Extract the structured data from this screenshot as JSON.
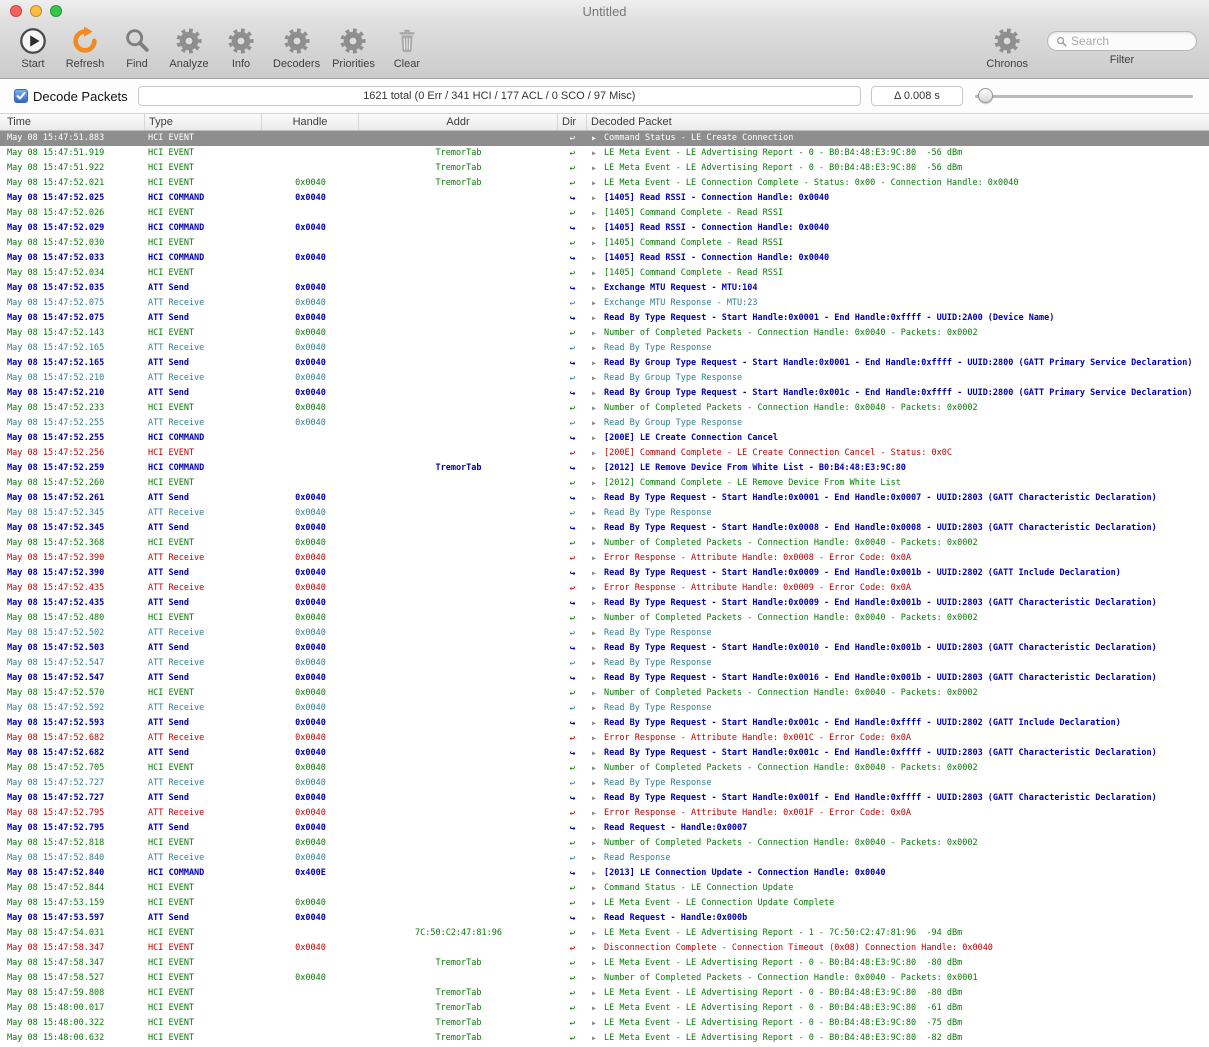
{
  "window": {
    "title": "Untitled"
  },
  "toolbar": {
    "items": [
      {
        "label": "Start",
        "icon": "play"
      },
      {
        "label": "Refresh",
        "icon": "refresh"
      },
      {
        "label": "Find",
        "icon": "search"
      },
      {
        "label": "Analyze",
        "icon": "gear"
      },
      {
        "label": "Info",
        "icon": "gear"
      },
      {
        "label": "Decoders",
        "icon": "gear"
      },
      {
        "label": "Priorities",
        "icon": "gear"
      },
      {
        "label": "Clear",
        "icon": "trash"
      }
    ],
    "chronos": {
      "label": "Chronos",
      "icon": "gear"
    },
    "filter": {
      "label": "Filter",
      "placeholder": "Search"
    }
  },
  "controls": {
    "decode_packets_label": "Decode Packets",
    "decode_packets_checked": true,
    "summary": "1621 total (0 Err / 341 HCI / 177 ACL / 0 SCO / 97 Misc)",
    "delta": "Δ 0.008 s"
  },
  "icons": {
    "dir_in": "↩",
    "dir_out": "↪",
    "disclosure": "▶"
  },
  "colors": {
    "traffic_lights": [
      "#FC605C",
      "#FDBC40",
      "#34C749"
    ],
    "row_green": "#077A07",
    "row_blue": "#0000B4",
    "row_red": "#C00000",
    "row_teal": "#2E7E8E",
    "selected_bg": "#8E8E8E",
    "selected_text": "#FFFFFF",
    "checkbox_blue": "#2E66D0",
    "accent_orange": "#F28A22"
  },
  "table": {
    "columns": [
      "Time",
      "Type",
      "Handle",
      "Addr",
      "Dir",
      "Decoded Packet"
    ],
    "rows": [
      {
        "time": "May 08 15:47:51.883",
        "type": "HCI EVENT",
        "handle": "",
        "addr": "",
        "dir": "in",
        "packet": "Command Status - LE Create Connection",
        "color": "selected"
      },
      {
        "time": "May 08 15:47:51.919",
        "type": "HCI EVENT",
        "handle": "",
        "addr": "TremorTab",
        "dir": "in",
        "packet": "LE Meta Event - LE Advertising Report - 0 - B0:B4:48:E3:9C:80  -56 dBm",
        "color": "green"
      },
      {
        "time": "May 08 15:47:51.922",
        "type": "HCI EVENT",
        "handle": "",
        "addr": "TremorTab",
        "dir": "in",
        "packet": "LE Meta Event - LE Advertising Report - 0 - B0:B4:48:E3:9C:80  -56 dBm",
        "color": "green"
      },
      {
        "time": "May 08 15:47:52.021",
        "type": "HCI EVENT",
        "handle": "0x0040",
        "addr": "TremorTab",
        "dir": "in",
        "packet": "LE Meta Event - LE Connection Complete - Status: 0x00 - Connection Handle: 0x0040",
        "color": "green"
      },
      {
        "time": "May 08 15:47:52.025",
        "type": "HCI COMMAND",
        "handle": "0x0040",
        "addr": "",
        "dir": "out",
        "packet": "[1405] Read RSSI - Connection Handle: 0x0040",
        "color": "blue"
      },
      {
        "time": "May 08 15:47:52.026",
        "type": "HCI EVENT",
        "handle": "",
        "addr": "",
        "dir": "in",
        "packet": "[1405] Command Complete - Read RSSI",
        "color": "green"
      },
      {
        "time": "May 08 15:47:52.029",
        "type": "HCI COMMAND",
        "handle": "0x0040",
        "addr": "",
        "dir": "out",
        "packet": "[1405] Read RSSI - Connection Handle: 0x0040",
        "color": "blue"
      },
      {
        "time": "May 08 15:47:52.030",
        "type": "HCI EVENT",
        "handle": "",
        "addr": "",
        "dir": "in",
        "packet": "[1405] Command Complete - Read RSSI",
        "color": "green"
      },
      {
        "time": "May 08 15:47:52.033",
        "type": "HCI COMMAND",
        "handle": "0x0040",
        "addr": "",
        "dir": "out",
        "packet": "[1405] Read RSSI - Connection Handle: 0x0040",
        "color": "blue"
      },
      {
        "time": "May 08 15:47:52.034",
        "type": "HCI EVENT",
        "handle": "",
        "addr": "",
        "dir": "in",
        "packet": "[1405] Command Complete - Read RSSI",
        "color": "green"
      },
      {
        "time": "May 08 15:47:52.035",
        "type": "ATT Send",
        "handle": "0x0040",
        "addr": "",
        "dir": "out",
        "packet": "Exchange MTU Request - MTU:104",
        "color": "blue"
      },
      {
        "time": "May 08 15:47:52.075",
        "type": "ATT Receive",
        "handle": "0x0040",
        "addr": "",
        "dir": "in",
        "packet": "Exchange MTU Response - MTU:23",
        "color": "teal"
      },
      {
        "time": "May 08 15:47:52.075",
        "type": "ATT Send",
        "handle": "0x0040",
        "addr": "",
        "dir": "out",
        "packet": "Read By Type Request - Start Handle:0x0001 - End Handle:0xffff - UUID:2A00 (Device Name)",
        "color": "blue"
      },
      {
        "time": "May 08 15:47:52.143",
        "type": "HCI EVENT",
        "handle": "0x0040",
        "addr": "",
        "dir": "in",
        "packet": "Number of Completed Packets - Connection Handle: 0x0040 - Packets: 0x0002",
        "color": "green"
      },
      {
        "time": "May 08 15:47:52.165",
        "type": "ATT Receive",
        "handle": "0x0040",
        "addr": "",
        "dir": "in",
        "packet": "Read By Type Response",
        "color": "teal"
      },
      {
        "time": "May 08 15:47:52.165",
        "type": "ATT Send",
        "handle": "0x0040",
        "addr": "",
        "dir": "out",
        "packet": "Read By Group Type Request - Start Handle:0x0001 - End Handle:0xffff - UUID:2800 (GATT Primary Service Declaration)",
        "color": "blue"
      },
      {
        "time": "May 08 15:47:52.210",
        "type": "ATT Receive",
        "handle": "0x0040",
        "addr": "",
        "dir": "in",
        "packet": "Read By Group Type Response",
        "color": "teal"
      },
      {
        "time": "May 08 15:47:52.210",
        "type": "ATT Send",
        "handle": "0x0040",
        "addr": "",
        "dir": "out",
        "packet": "Read By Group Type Request - Start Handle:0x001c - End Handle:0xffff - UUID:2800 (GATT Primary Service Declaration)",
        "color": "blue"
      },
      {
        "time": "May 08 15:47:52.233",
        "type": "HCI EVENT",
        "handle": "0x0040",
        "addr": "",
        "dir": "in",
        "packet": "Number of Completed Packets - Connection Handle: 0x0040 - Packets: 0x0002",
        "color": "green"
      },
      {
        "time": "May 08 15:47:52.255",
        "type": "ATT Receive",
        "handle": "0x0040",
        "addr": "",
        "dir": "in",
        "packet": "Read By Group Type Response",
        "color": "teal"
      },
      {
        "time": "May 08 15:47:52.255",
        "type": "HCI COMMAND",
        "handle": "",
        "addr": "",
        "dir": "out",
        "packet": "[200E] LE Create Connection Cancel",
        "color": "blue"
      },
      {
        "time": "May 08 15:47:52.256",
        "type": "HCI EVENT",
        "handle": "",
        "addr": "",
        "dir": "in",
        "packet": "[200E] Command Complete - LE Create Connection Cancel - Status: 0x0C",
        "color": "red"
      },
      {
        "time": "May 08 15:47:52.259",
        "type": "HCI COMMAND",
        "handle": "",
        "addr": "TremorTab",
        "dir": "out",
        "packet": "[2012] LE Remove Device From White List - B0:B4:48:E3:9C:80",
        "color": "blue"
      },
      {
        "time": "May 08 15:47:52.260",
        "type": "HCI EVENT",
        "handle": "",
        "addr": "",
        "dir": "in",
        "packet": "[2012] Command Complete - LE Remove Device From White List",
        "color": "green"
      },
      {
        "time": "May 08 15:47:52.261",
        "type": "ATT Send",
        "handle": "0x0040",
        "addr": "",
        "dir": "out",
        "packet": "Read By Type Request - Start Handle:0x0001 - End Handle:0x0007 - UUID:2803 (GATT Characteristic Declaration)",
        "color": "blue"
      },
      {
        "time": "May 08 15:47:52.345",
        "type": "ATT Receive",
        "handle": "0x0040",
        "addr": "",
        "dir": "in",
        "packet": "Read By Type Response",
        "color": "teal"
      },
      {
        "time": "May 08 15:47:52.345",
        "type": "ATT Send",
        "handle": "0x0040",
        "addr": "",
        "dir": "out",
        "packet": "Read By Type Request - Start Handle:0x0008 - End Handle:0x0008 - UUID:2803 (GATT Characteristic Declaration)",
        "color": "blue"
      },
      {
        "time": "May 08 15:47:52.368",
        "type": "HCI EVENT",
        "handle": "0x0040",
        "addr": "",
        "dir": "in",
        "packet": "Number of Completed Packets - Connection Handle: 0x0040 - Packets: 0x0002",
        "color": "green"
      },
      {
        "time": "May 08 15:47:52.390",
        "type": "ATT Receive",
        "handle": "0x0040",
        "addr": "",
        "dir": "in",
        "packet": "Error Response - Attribute Handle: 0x0008 - Error Code: 0x0A",
        "color": "red"
      },
      {
        "time": "May 08 15:47:52.390",
        "type": "ATT Send",
        "handle": "0x0040",
        "addr": "",
        "dir": "out",
        "packet": "Read By Type Request - Start Handle:0x0009 - End Handle:0x001b - UUID:2802 (GATT Include Declaration)",
        "color": "blue"
      },
      {
        "time": "May 08 15:47:52.435",
        "type": "ATT Receive",
        "handle": "0x0040",
        "addr": "",
        "dir": "in",
        "packet": "Error Response - Attribute Handle: 0x0009 - Error Code: 0x0A",
        "color": "red"
      },
      {
        "time": "May 08 15:47:52.435",
        "type": "ATT Send",
        "handle": "0x0040",
        "addr": "",
        "dir": "out",
        "packet": "Read By Type Request - Start Handle:0x0009 - End Handle:0x001b - UUID:2803 (GATT Characteristic Declaration)",
        "color": "blue"
      },
      {
        "time": "May 08 15:47:52.480",
        "type": "HCI EVENT",
        "handle": "0x0040",
        "addr": "",
        "dir": "in",
        "packet": "Number of Completed Packets - Connection Handle: 0x0040 - Packets: 0x0002",
        "color": "green"
      },
      {
        "time": "May 08 15:47:52.502",
        "type": "ATT Receive",
        "handle": "0x0040",
        "addr": "",
        "dir": "in",
        "packet": "Read By Type Response",
        "color": "teal"
      },
      {
        "time": "May 08 15:47:52.503",
        "type": "ATT Send",
        "handle": "0x0040",
        "addr": "",
        "dir": "out",
        "packet": "Read By Type Request - Start Handle:0x0010 - End Handle:0x001b - UUID:2803 (GATT Characteristic Declaration)",
        "color": "blue"
      },
      {
        "time": "May 08 15:47:52.547",
        "type": "ATT Receive",
        "handle": "0x0040",
        "addr": "",
        "dir": "in",
        "packet": "Read By Type Response",
        "color": "teal"
      },
      {
        "time": "May 08 15:47:52.547",
        "type": "ATT Send",
        "handle": "0x0040",
        "addr": "",
        "dir": "out",
        "packet": "Read By Type Request - Start Handle:0x0016 - End Handle:0x001b - UUID:2803 (GATT Characteristic Declaration)",
        "color": "blue"
      },
      {
        "time": "May 08 15:47:52.570",
        "type": "HCI EVENT",
        "handle": "0x0040",
        "addr": "",
        "dir": "in",
        "packet": "Number of Completed Packets - Connection Handle: 0x0040 - Packets: 0x0002",
        "color": "green"
      },
      {
        "time": "May 08 15:47:52.592",
        "type": "ATT Receive",
        "handle": "0x0040",
        "addr": "",
        "dir": "in",
        "packet": "Read By Type Response",
        "color": "teal"
      },
      {
        "time": "May 08 15:47:52.593",
        "type": "ATT Send",
        "handle": "0x0040",
        "addr": "",
        "dir": "out",
        "packet": "Read By Type Request - Start Handle:0x001c - End Handle:0xffff - UUID:2802 (GATT Include Declaration)",
        "color": "blue"
      },
      {
        "time": "May 08 15:47:52.682",
        "type": "ATT Receive",
        "handle": "0x0040",
        "addr": "",
        "dir": "in",
        "packet": "Error Response - Attribute Handle: 0x001C - Error Code: 0x0A",
        "color": "red"
      },
      {
        "time": "May 08 15:47:52.682",
        "type": "ATT Send",
        "handle": "0x0040",
        "addr": "",
        "dir": "out",
        "packet": "Read By Type Request - Start Handle:0x001c - End Handle:0xffff - UUID:2803 (GATT Characteristic Declaration)",
        "color": "blue"
      },
      {
        "time": "May 08 15:47:52.705",
        "type": "HCI EVENT",
        "handle": "0x0040",
        "addr": "",
        "dir": "in",
        "packet": "Number of Completed Packets - Connection Handle: 0x0040 - Packets: 0x0002",
        "color": "green"
      },
      {
        "time": "May 08 15:47:52.727",
        "type": "ATT Receive",
        "handle": "0x0040",
        "addr": "",
        "dir": "in",
        "packet": "Read By Type Response",
        "color": "teal"
      },
      {
        "time": "May 08 15:47:52.727",
        "type": "ATT Send",
        "handle": "0x0040",
        "addr": "",
        "dir": "out",
        "packet": "Read By Type Request - Start Handle:0x001f - End Handle:0xffff - UUID:2803 (GATT Characteristic Declaration)",
        "color": "blue"
      },
      {
        "time": "May 08 15:47:52.795",
        "type": "ATT Receive",
        "handle": "0x0040",
        "addr": "",
        "dir": "in",
        "packet": "Error Response - Attribute Handle: 0x001F - Error Code: 0x0A",
        "color": "red"
      },
      {
        "time": "May 08 15:47:52.795",
        "type": "ATT Send",
        "handle": "0x0040",
        "addr": "",
        "dir": "out",
        "packet": "Read Request - Handle:0x0007",
        "color": "blue"
      },
      {
        "time": "May 08 15:47:52.818",
        "type": "HCI EVENT",
        "handle": "0x0040",
        "addr": "",
        "dir": "in",
        "packet": "Number of Completed Packets - Connection Handle: 0x0040 - Packets: 0x0002",
        "color": "green"
      },
      {
        "time": "May 08 15:47:52.840",
        "type": "ATT Receive",
        "handle": "0x0040",
        "addr": "",
        "dir": "in",
        "packet": "Read Response",
        "color": "teal"
      },
      {
        "time": "May 08 15:47:52.840",
        "type": "HCI COMMAND",
        "handle": "0x400E",
        "addr": "",
        "dir": "out",
        "packet": "[2013] LE Connection Update - Connection Handle: 0x0040",
        "color": "blue"
      },
      {
        "time": "May 08 15:47:52.844",
        "type": "HCI EVENT",
        "handle": "",
        "addr": "",
        "dir": "in",
        "packet": "Command Status - LE Connection Update",
        "color": "green"
      },
      {
        "time": "May 08 15:47:53.159",
        "type": "HCI EVENT",
        "handle": "0x0040",
        "addr": "",
        "dir": "in",
        "packet": "LE Meta Event - LE Connection Update Complete",
        "color": "green"
      },
      {
        "time": "May 08 15:47:53.597",
        "type": "ATT Send",
        "handle": "0x0040",
        "addr": "",
        "dir": "out",
        "packet": "Read Request - Handle:0x000b",
        "color": "blue"
      },
      {
        "time": "May 08 15:47:54.031",
        "type": "HCI EVENT",
        "handle": "",
        "addr": "7C:50:C2:47:81:96",
        "dir": "in",
        "packet": "LE Meta Event - LE Advertising Report - 1 - 7C:50:C2:47:81:96  -94 dBm",
        "color": "green"
      },
      {
        "time": "May 08 15:47:58.347",
        "type": "HCI EVENT",
        "handle": "0x0040",
        "addr": "",
        "dir": "in",
        "packet": "Disconnection Complete - Connection Timeout (0x08) Connection Handle: 0x0040",
        "color": "red"
      },
      {
        "time": "May 08 15:47:58.347",
        "type": "HCI EVENT",
        "handle": "",
        "addr": "TremorTab",
        "dir": "in",
        "packet": "LE Meta Event - LE Advertising Report - 0 - B0:B4:48:E3:9C:80  -80 dBm",
        "color": "green"
      },
      {
        "time": "May 08 15:47:58.527",
        "type": "HCI EVENT",
        "handle": "0x0040",
        "addr": "",
        "dir": "in",
        "packet": "Number of Completed Packets - Connection Handle: 0x0040 - Packets: 0x0001",
        "color": "green"
      },
      {
        "time": "May 08 15:47:59.808",
        "type": "HCI EVENT",
        "handle": "",
        "addr": "TremorTab",
        "dir": "in",
        "packet": "LE Meta Event - LE Advertising Report - 0 - B0:B4:48:E3:9C:80  -80 dBm",
        "color": "green"
      },
      {
        "time": "May 08 15:48:00.017",
        "type": "HCI EVENT",
        "handle": "",
        "addr": "TremorTab",
        "dir": "in",
        "packet": "LE Meta Event - LE Advertising Report - 0 - B0:B4:48:E3:9C:80  -61 dBm",
        "color": "green"
      },
      {
        "time": "May 08 15:48:00.322",
        "type": "HCI EVENT",
        "handle": "",
        "addr": "TremorTab",
        "dir": "in",
        "packet": "LE Meta Event - LE Advertising Report - 0 - B0:B4:48:E3:9C:80  -75 dBm",
        "color": "green"
      },
      {
        "time": "May 08 15:48:00.632",
        "type": "HCI EVENT",
        "handle": "",
        "addr": "TremorTab",
        "dir": "in",
        "packet": "LE Meta Event - LE Advertising Report - 0 - B0:B4:48:E3:9C:80  -82 dBm",
        "color": "green"
      }
    ]
  }
}
